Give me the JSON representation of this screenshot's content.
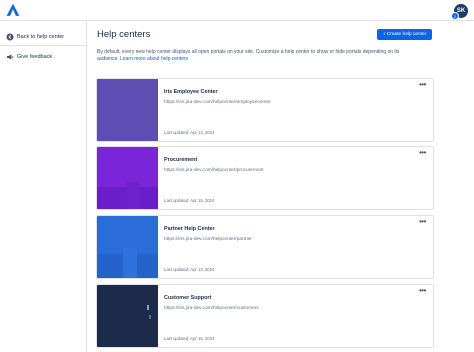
{
  "header": {
    "user_initials": "SK",
    "notification_count": "2"
  },
  "sidebar": {
    "back_label": "Back to help center",
    "feedback_label": "Give feedback"
  },
  "main": {
    "title": "Help centers",
    "create_button_label": "+ Create help center",
    "description": "By default, every new help center displays all open portals on your site. Customize a help center to show or hide portals depending on its audience.",
    "learn_more_label": "Learn more about help centers",
    "cards": [
      {
        "name": "Iris Employee Center",
        "url": "https://iris.jira-dev.com/helpcenter/employeecenter",
        "updated": "Last updated: Apr 12, 2024",
        "color": "#5e4db2"
      },
      {
        "name": "Procurement",
        "url": "https://iris.jira-dev.com/helpcenter/procurement",
        "updated": "Last updated: Apr 15, 2024",
        "color": "#7a25d8"
      },
      {
        "name": "Partner Help Center",
        "url": "https://iris.jira-dev.com/helpcenter/partner",
        "updated": "Last updated: Apr 13, 2024",
        "color": "#2a6dd8"
      },
      {
        "name": "Customer Support",
        "url": "https://iris.jira-dev.com/helpcenter/customers",
        "updated": "Last updated: Apr 15, 2024",
        "color": "#1c2b4a"
      }
    ],
    "more_icon": "ellipsis-icon"
  }
}
